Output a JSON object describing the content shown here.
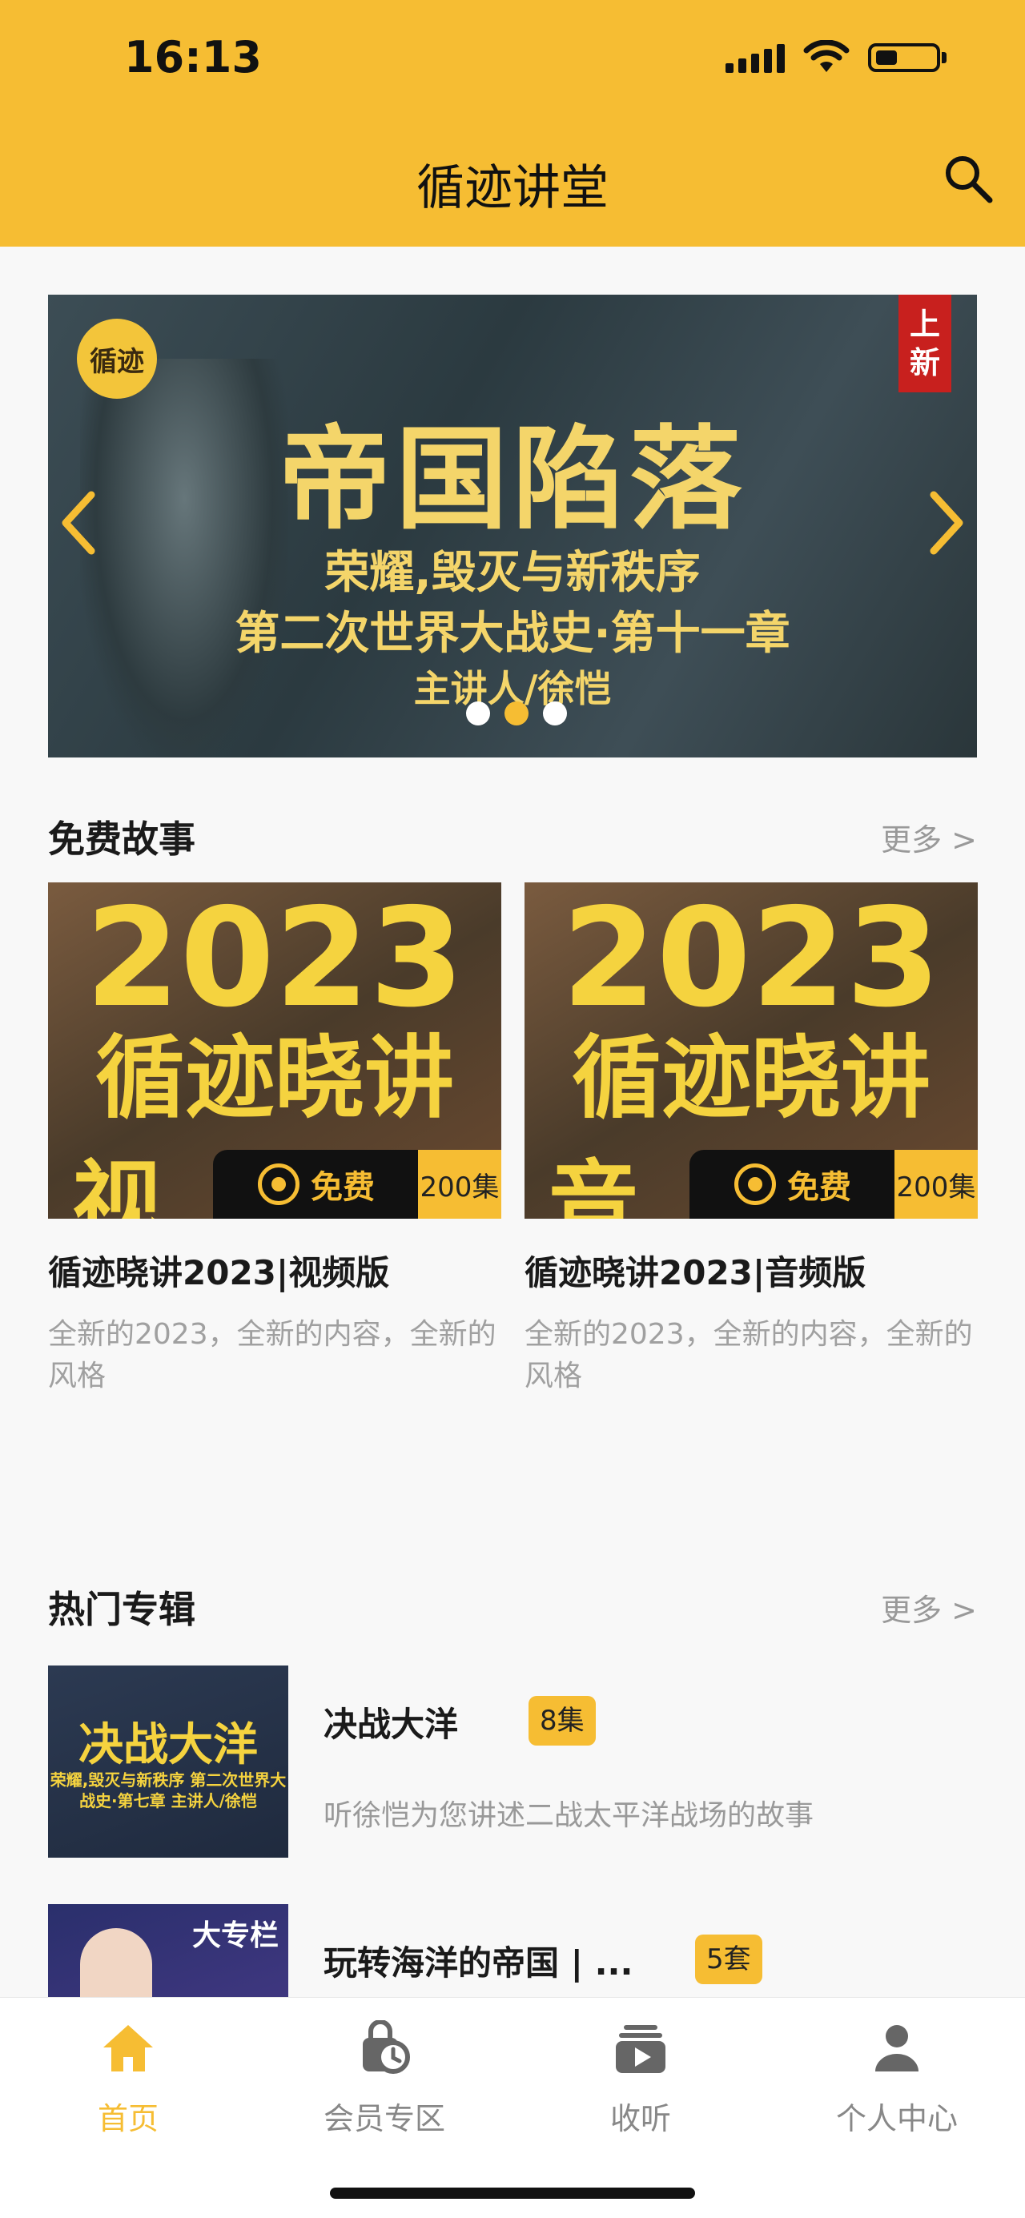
{
  "status_bar": {
    "time": "16:13"
  },
  "header": {
    "title": "循迹讲堂"
  },
  "banner": {
    "logo_text": "循迹",
    "badge_line1": "上",
    "badge_line2": "新",
    "title": "帝国陷落",
    "subtitle1": "荣耀,毁灭与新秩序",
    "subtitle2": "第二次世界大战史·第十一章",
    "author": "主讲人/徐恺",
    "pages": 3,
    "active_page": 2
  },
  "free_section": {
    "title": "免费故事",
    "more": "更多 >",
    "cards": [
      {
        "thumb_year": "2023",
        "thumb_line": "循迹晓讲",
        "thumb_line2": "视 频 版",
        "free_label": "免费",
        "count": "200集",
        "title": "循迹晓讲2023|视频版",
        "desc": "全新的2023，全新的内容，全新的风格"
      },
      {
        "thumb_year": "2023",
        "thumb_line": "循迹晓讲",
        "thumb_line2": "音 频 版",
        "free_label": "免费",
        "count": "200集",
        "title": "循迹晓讲2023|音频版",
        "desc": "全新的2023，全新的内容，全新的风格"
      }
    ]
  },
  "hot_section": {
    "title": "热门专辑",
    "more": "更多 >",
    "albums": [
      {
        "thumb_title": "决战大洋",
        "thumb_sub": "荣耀,毁灭与新秩序 第二次世界大战史·第七章 主讲人/徐恺",
        "title": "决战大洋",
        "count": "8集",
        "desc": "听徐恺为您讲述二战太平洋战场的故事"
      },
      {
        "thumb_title": "大专栏",
        "title": "玩转海洋的帝国 | ...",
        "count": "5套"
      }
    ]
  },
  "tabbar": {
    "items": [
      {
        "label": "首页",
        "icon": "home-icon",
        "active": true
      },
      {
        "label": "会员专区",
        "icon": "member-clock-icon",
        "active": false
      },
      {
        "label": "收听",
        "icon": "listen-play-icon",
        "active": false
      },
      {
        "label": "个人中心",
        "icon": "profile-icon",
        "active": false
      }
    ]
  },
  "colors": {
    "accent": "#f6bd33",
    "text": "#1a1a1a",
    "muted": "#999999"
  }
}
